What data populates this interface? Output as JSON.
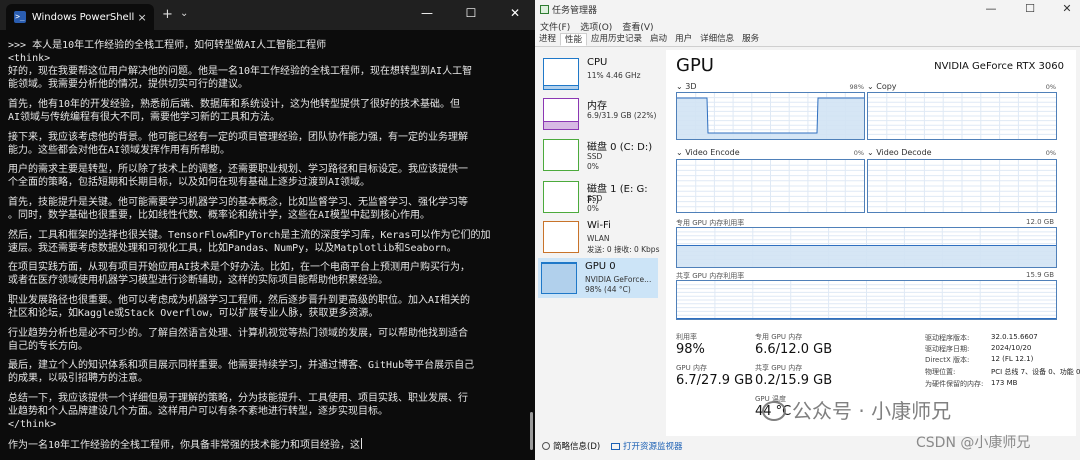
{
  "powershell": {
    "tab_title": "Windows PowerShell",
    "tab_close": "×",
    "new_tab": "+",
    "dropdown": "⌄",
    "btn_min": "—",
    "btn_max": "☐",
    "btn_close": "✕",
    "lines": [
      ">>> 本人是10年工作经验的全栈工程师，如何转型做AI人工智能工程师",
      "<think>",
      "好的，现在我要帮这位用户解决他的问题。他是一名10年工作经验的全栈工程师，现在想转型到AI人工智",
      "能领域。我需要分析他的情况，提供切实可行的建议。",
      "",
      "首先，他有10年的开发经验，熟悉前后端、数据库和系统设计，这为他转型提供了很好的技术基础。但",
      "AI领域与传统编程有很大不同，需要他学习新的工具和方法。",
      "",
      "接下来，我应该考虑他的背景。他可能已经有一定的项目管理经验，团队协作能力强，有一定的业务理解",
      "能力。这些都会对他在AI领域发挥作用有所帮助。",
      "",
      "用户的需求主要是转型，所以除了技术上的调整，还需要职业规划、学习路径和目标设定。我应该提供一",
      "个全面的策略，包括短期和长期目标，以及如何在现有基础上逐步过渡到AI领域。",
      "",
      "首先，技能提升是关键。他可能需要学习机器学习的基本概念，比如监督学习、无监督学习、强化学习等",
      "。同时，数学基础也很重要，比如线性代数、概率论和统计学，这些在AI模型中起到核心作用。",
      "",
      "然后，工具和框架的选择也很关键。TensorFlow和PyTorch是主流的深度学习库，Keras可以作为它们的加",
      "速层。我还需要考虑数据处理和可视化工具，比如Pandas、NumPy，以及Matplotlib和Seaborn。",
      "",
      "在项目实践方面，从现有项目开始应用AI技术是个好办法。比如，在一个电商平台上预测用户购买行为，",
      "或者在医疗领域使用机器学习模型进行诊断辅助，这样的实际项目能帮助他积累经验。",
      "",
      "职业发展路径也很重要。他可以考虑成为机器学习工程师，然后逐步晋升到更高级的职位。加入AI相关的",
      "社区和论坛，如Kaggle或Stack Overflow，可以扩展专业人脉，获取更多资源。",
      "",
      "行业趋势分析也是必不可少的。了解自然语言处理、计算机视觉等热门领域的发展，可以帮助他找到适合",
      "自己的专长方向。",
      "",
      "最后，建立个人的知识体系和项目展示同样重要。他需要持续学习，并通过博客、GitHub等平台展示自己",
      "的成果，以吸引招聘方的注意。",
      "",
      "总结一下，我应该提供一个详细但易于理解的策略，分为技能提升、工具使用、项目实践、职业发展、行",
      "业趋势和个人品牌建设几个方面。这样用户可以有条不紊地进行转型，逐步实现目标。",
      "</think>",
      "",
      "作为一名10年工作经验的全栈工程师，你具备非常强的技术能力和项目经验，这"
    ]
  },
  "taskmanager": {
    "title": "任务管理器",
    "btn_min": "—",
    "btn_max": "☐",
    "btn_close": "✕",
    "menu": [
      "文件(F)",
      "选项(O)",
      "查看(V)"
    ],
    "tabs": [
      "进程",
      "性能",
      "应用历史记录",
      "启动",
      "用户",
      "详细信息",
      "服务"
    ],
    "active_tab": 1,
    "sidebar": [
      {
        "name": "CPU",
        "sub1": "11%  4.46 GHz",
        "sub2": "",
        "sub3": "",
        "color": "#1f78c8",
        "fill": 0.11
      },
      {
        "name": "内存",
        "sub1": "6.9/31.9 GB (22%)",
        "sub2": "",
        "sub3": "",
        "color": "#8b37b3",
        "fill": 0.22
      },
      {
        "name": "磁盘 0 (C: D:)",
        "sub1": "SSD",
        "sub2": "0%",
        "sub3": "",
        "color": "#4caa3c",
        "fill": 0.0
      },
      {
        "name": "磁盘 1 (E: G: F:)",
        "sub1": "SSD",
        "sub2": "0%",
        "sub3": "",
        "color": "#4caa3c",
        "fill": 0.0
      },
      {
        "name": "Wi-Fi",
        "sub1": "WLAN",
        "sub2": "发送: 0 接收: 0 Kbps",
        "sub3": "",
        "color": "#c8732a",
        "fill": 0.0
      },
      {
        "name": "GPU 0",
        "sub1": "NVIDIA GeForce...",
        "sub2": "98% (44 °C)",
        "sub3": "",
        "color": "#1f78c8",
        "fill": 0.98
      }
    ],
    "selected_index": 5,
    "gpu": {
      "heading": "GPU",
      "model": "NVIDIA GeForce RTX 3060",
      "engines": [
        {
          "label": "⌄ 3D",
          "pct": "98%"
        },
        {
          "label": "⌄ Copy",
          "pct": "0%"
        },
        {
          "label": "⌄ Video Encode",
          "pct": "0%"
        },
        {
          "label": "⌄ Video Decode",
          "pct": "0%"
        }
      ],
      "dedicated_label": "专用 GPU 内存利用率",
      "dedicated_max": "12.0 GB",
      "dedicated_fill": 0.55,
      "shared_label": "共享 GPU 内存利用率",
      "shared_max": "15.9 GB",
      "shared_fill": 0.013,
      "stats": {
        "util_label": "利用率",
        "util_val": "98%",
        "ded_label": "专用 GPU 内存",
        "ded_val": "6.6/12.0 GB",
        "mem_label": "GPU 内存",
        "mem_val": "6.7/27.9 GB",
        "shared_label": "共享 GPU 内存",
        "shared_val": "0.2/15.9 GB",
        "temp_label": "GPU 温度",
        "temp_val": "44 °C"
      },
      "info": [
        {
          "k": "驱动程序版本:",
          "v": "32.0.15.6607"
        },
        {
          "k": "驱动程序日期:",
          "v": "2024/10/20"
        },
        {
          "k": "DirectX 版本:",
          "v": "12 (FL 12.1)"
        },
        {
          "k": "物理位置:",
          "v": "PCI 总线 7、设备 0、功能 0"
        },
        {
          "k": "为硬件保留的内存:",
          "v": "173 MB"
        }
      ]
    },
    "footer": {
      "summary": "简略信息(D)",
      "monitor": "打开资源监视器"
    }
  },
  "watermark": {
    "wechat": "公众号 · 小康师兄",
    "csdn": "CSDN @小康师兄"
  }
}
